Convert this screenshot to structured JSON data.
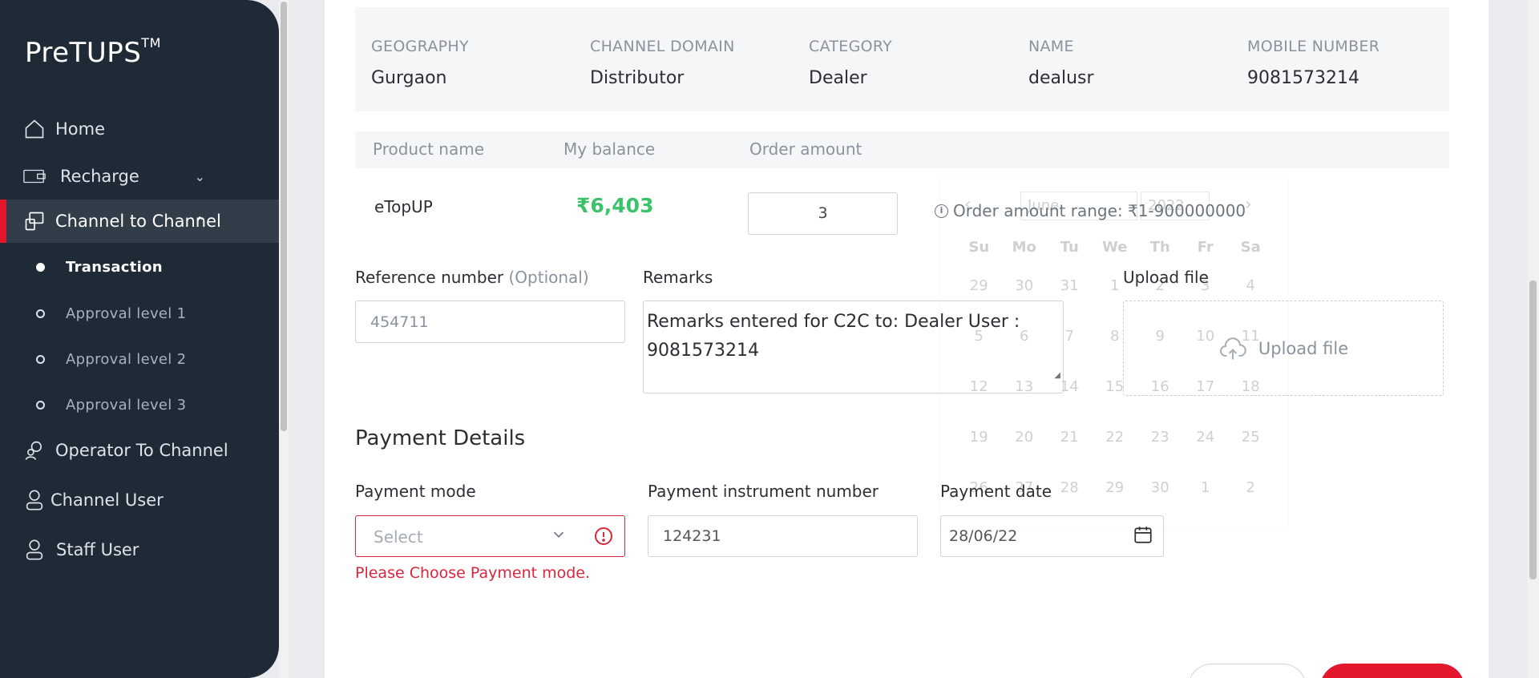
{
  "sidebar": {
    "logo": "PreTUPS",
    "logo_mark": "TM",
    "items": [
      {
        "label": "Home",
        "icon": "home-icon"
      },
      {
        "label": "Recharge",
        "icon": "recharge-icon"
      },
      {
        "label": "Channel to Channel",
        "icon": "channel-transfer-icon"
      },
      {
        "label": "Operator To Channel",
        "icon": "operator-icon"
      },
      {
        "label": "Channel User",
        "icon": "user-icon"
      },
      {
        "label": "Staff User",
        "icon": "user-icon"
      }
    ],
    "sub_items": [
      {
        "label": "Transaction",
        "active": true
      },
      {
        "label": "Approval level 1"
      },
      {
        "label": "Approval level 2"
      },
      {
        "label": "Approval level 3"
      }
    ]
  },
  "user_info": {
    "geography": {
      "label": "GEOGRAPHY",
      "value": "Gurgaon"
    },
    "domain": {
      "label": "CHANNEL DOMAIN",
      "value": "Distributor"
    },
    "category": {
      "label": "CATEGORY",
      "value": "Dealer"
    },
    "name": {
      "label": "NAME",
      "value": "dealusr"
    },
    "mobile": {
      "label": "MOBILE NUMBER",
      "value": "9081573214"
    }
  },
  "product_table": {
    "headers": [
      "Product name",
      "My balance",
      "Order amount"
    ],
    "product": "eTopUP",
    "balance": "₹6,403",
    "order_amount": "3",
    "range_note": "Order amount range: ₹1-900000000"
  },
  "form": {
    "reference_label": "Reference number",
    "reference_optional": "(Optional)",
    "reference_value": "454711",
    "remarks_label": "Remarks",
    "remarks_value": "Remarks entered for C2C to: Dealer User : 9081573214",
    "upload_label": "Upload file",
    "upload_button": "Upload file"
  },
  "payment": {
    "title": "Payment Details",
    "mode_label": "Payment mode",
    "mode_placeholder": "Select",
    "mode_error": "Please Choose Payment mode.",
    "instrument_label": "Payment instrument number",
    "instrument_value": "124231",
    "date_label": "Payment date",
    "date_value": "28/06/22"
  },
  "datepicker": {
    "month": "June",
    "year": "2022",
    "weekdays": [
      "Su",
      "Mo",
      "Tu",
      "We",
      "Th",
      "Fr",
      "Sa"
    ],
    "weeks": [
      [
        "29",
        "30",
        "31",
        "1",
        "2",
        "3",
        "4"
      ],
      [
        "5",
        "6",
        "7",
        "8",
        "9",
        "10",
        "11"
      ],
      [
        "12",
        "13",
        "14",
        "15",
        "16",
        "17",
        "18"
      ],
      [
        "19",
        "20",
        "21",
        "22",
        "23",
        "24",
        "25"
      ],
      [
        "26",
        "27",
        "28",
        "29",
        "30",
        "1",
        "2"
      ]
    ]
  },
  "colors": {
    "sidebar": "#1f2a37",
    "accent": "#e3182d",
    "balance": "#3cc36a",
    "error": "#d9263b"
  }
}
